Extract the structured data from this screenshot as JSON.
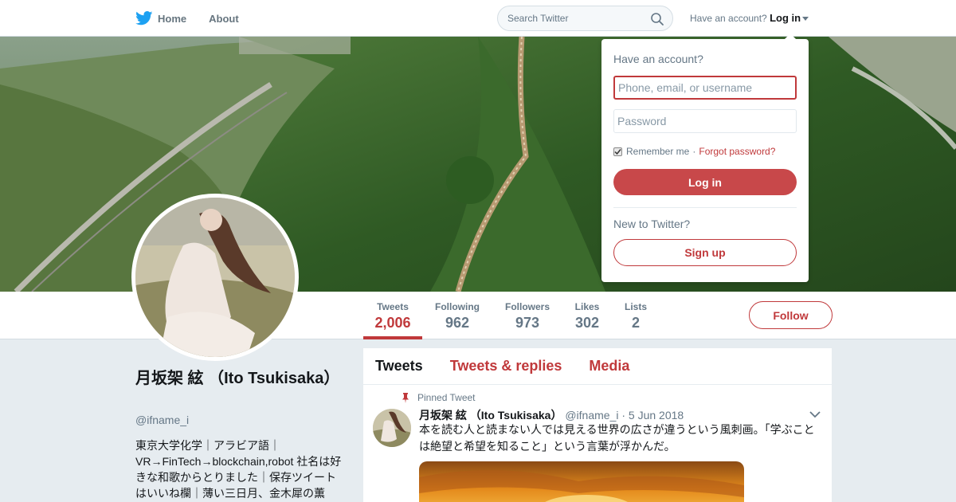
{
  "topbar": {
    "home_label": "Home",
    "about_label": "About",
    "search_placeholder": "Search Twitter",
    "account_prompt": "Have an account?",
    "login_label": "Log in"
  },
  "profile": {
    "name": "月坂架 絃 （Ito Tsukisaka）",
    "handle": "@ifname_i",
    "bio": "東京大学化学｜アラビア語｜VR→FinTech→blockchain,robot 社名は好きな和歌からとりました｜保存ツイートはいいね欄｜薄い三日月、金木犀の薫"
  },
  "stats": [
    {
      "label": "Tweets",
      "value": "2,006"
    },
    {
      "label": "Following",
      "value": "962"
    },
    {
      "label": "Followers",
      "value": "973"
    },
    {
      "label": "Likes",
      "value": "302"
    },
    {
      "label": "Lists",
      "value": "2"
    }
  ],
  "follow_label": "Follow",
  "timeline": {
    "tabs": [
      "Tweets",
      "Tweets & replies",
      "Media"
    ],
    "pinned_label": "Pinned Tweet",
    "tweet": {
      "author": "月坂架 絃 （Ito Tsukisaka）",
      "meta": "@ifname_i · 5 Jun 2018",
      "text": "本を読む人と読まない人では見える世界の広さが違うという風刺画。「学ぶことは絶望と希望を知ること」という言葉が浮かんだ。"
    }
  },
  "login_panel": {
    "title": "Have an account?",
    "username_placeholder": "Phone, email, or username",
    "password_placeholder": "Password",
    "remember_label": "Remember me",
    "separator": "·",
    "forgot_label": "Forgot password?",
    "login_button": "Log in",
    "new_prompt": "New to Twitter?",
    "signup_button": "Sign up"
  },
  "colors": {
    "accent": "#c0393b",
    "twitter_blue": "#1da1f2",
    "muted_text": "#657786",
    "page_bg": "#e6ecf0"
  }
}
